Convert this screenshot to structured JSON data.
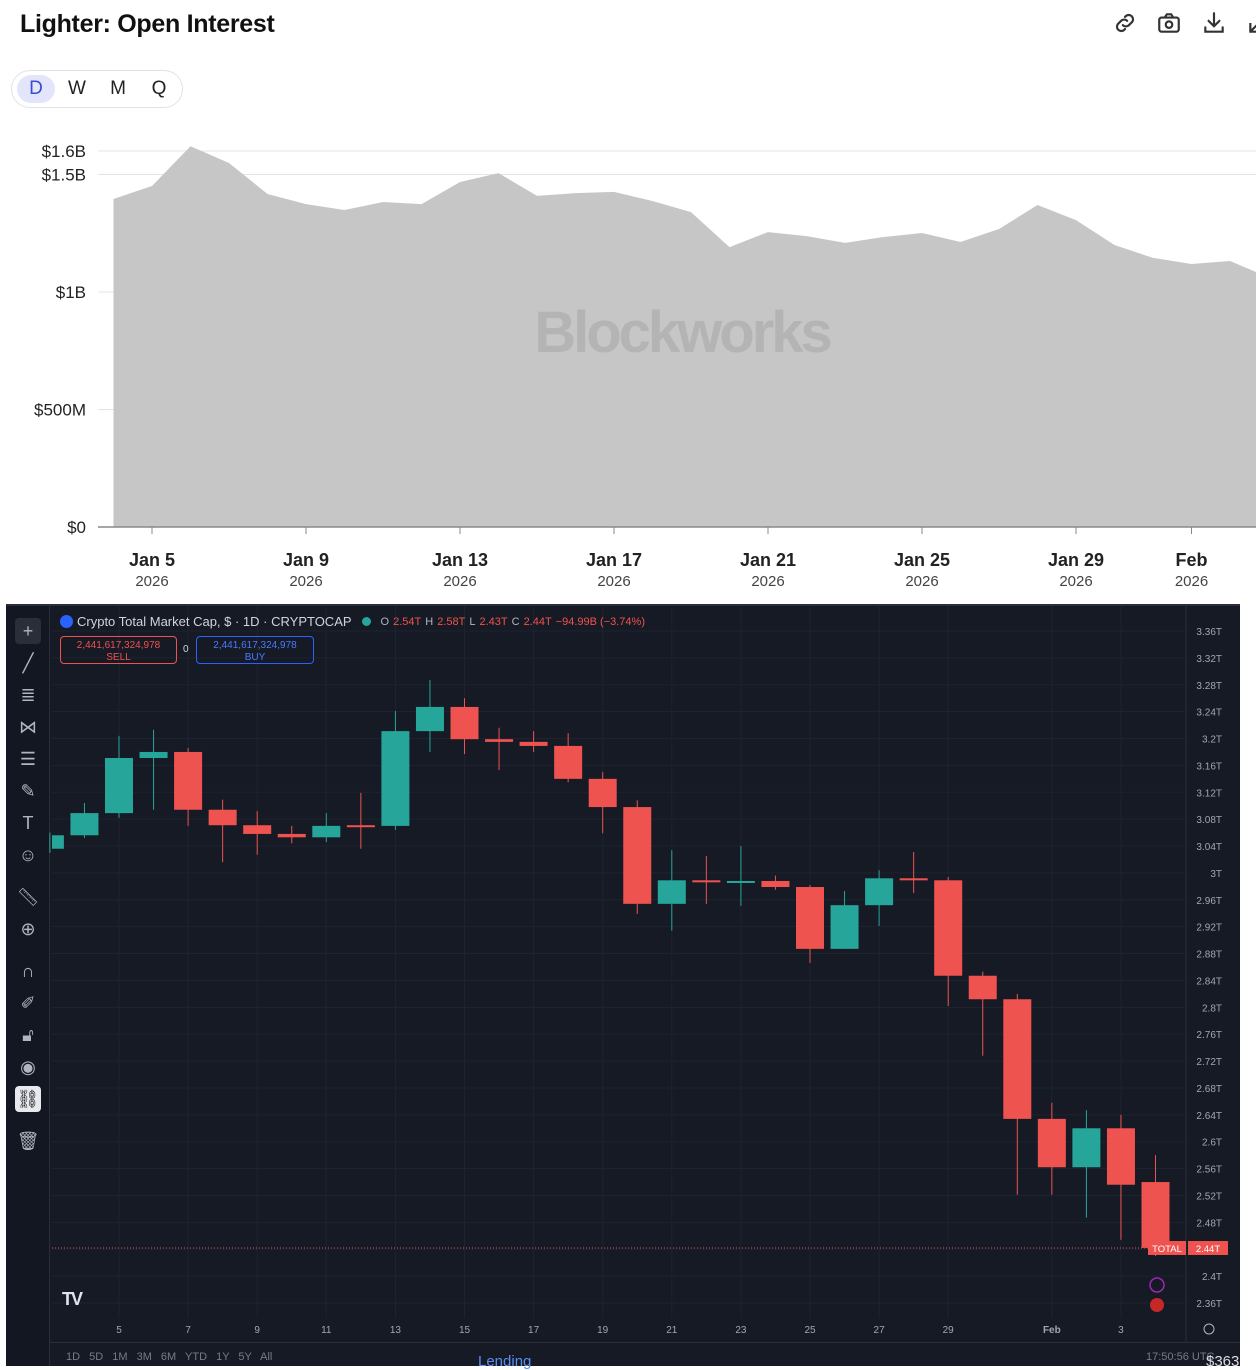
{
  "header": {
    "title": "Lighter: Open Interest",
    "icons": [
      "link-icon",
      "camera-icon",
      "download-icon",
      "collapse-icon"
    ]
  },
  "periods": [
    {
      "label": "D",
      "active": true
    },
    {
      "label": "W",
      "active": false
    },
    {
      "label": "M",
      "active": false
    },
    {
      "label": "Q",
      "active": false
    }
  ],
  "watermark": "Blockworks",
  "chart_data": [
    {
      "type": "area",
      "title": "Lighter: Open Interest",
      "fill_color": "#c6c6c6",
      "ylim": [
        0,
        1650000000
      ],
      "y_ticks": [
        {
          "v": 0,
          "label": "$0"
        },
        {
          "v": 500000000,
          "label": "$500M"
        },
        {
          "v": 1000000000,
          "label": "$1B"
        },
        {
          "v": 1500000000,
          "label": "$1.5B"
        },
        {
          "v": 1600000000,
          "label": "$1.6B"
        }
      ],
      "x_ticks": [
        {
          "day": 5,
          "label": "Jan 5",
          "year": "2026"
        },
        {
          "day": 9,
          "label": "Jan 9",
          "year": "2026"
        },
        {
          "day": 13,
          "label": "Jan 13",
          "year": "2026"
        },
        {
          "day": 17,
          "label": "Jan 17",
          "year": "2026"
        },
        {
          "day": 21,
          "label": "Jan 21",
          "year": "2026"
        },
        {
          "day": 25,
          "label": "Jan 25",
          "year": "2026"
        },
        {
          "day": 29,
          "label": "Jan 29",
          "year": "2026"
        },
        {
          "day": 32,
          "label": "Feb",
          "year": "2026"
        }
      ],
      "x_unit": "day of January 2026 (32 = Feb 1)",
      "x": [
        4,
        5,
        6,
        7,
        8,
        9,
        10,
        11,
        12,
        13,
        14,
        15,
        16,
        17,
        18,
        19,
        20,
        21,
        22,
        23,
        24,
        25,
        26,
        27,
        28,
        29,
        30,
        31,
        32,
        33,
        33.7
      ],
      "values": [
        1396000000.0,
        1451000000.0,
        1620000000.0,
        1549000000.0,
        1417000000.0,
        1374000000.0,
        1349000000.0,
        1383000000.0,
        1374000000.0,
        1468000000.0,
        1506000000.0,
        1409000000.0,
        1421000000.0,
        1426000000.0,
        1387000000.0,
        1340000000.0,
        1191000000.0,
        1255000000.0,
        1238000000.0,
        1209000000.0,
        1234000000.0,
        1251000000.0,
        1213000000.0,
        1268000000.0,
        1370000000.0,
        1306000000.0,
        1200000000.0,
        1145000000.0,
        1119000000.0,
        1132000000.0,
        1085000000.0
      ]
    },
    {
      "type": "candlestick",
      "title": "Crypto Total Market Cap, $ · 1D · CRYPTOCAP",
      "unit": "T",
      "ylim": [
        2.36,
        3.36
      ],
      "up_color": "#26a69a",
      "down_color": "#ef5350",
      "y_ticks": [
        "3.36T",
        "3.32T",
        "3.28T",
        "3.24T",
        "3.2T",
        "3.16T",
        "3.12T",
        "3.08T",
        "3.04T",
        "3T",
        "2.96T",
        "2.92T",
        "2.88T",
        "2.84T",
        "2.8T",
        "2.76T",
        "2.72T",
        "2.68T",
        "2.64T",
        "2.6T",
        "2.56T",
        "2.52T",
        "2.48T",
        "2.44T",
        "2.4T",
        "2.36T"
      ],
      "x_ticks": [
        {
          "day": 5,
          "label": "5"
        },
        {
          "day": 7,
          "label": "7"
        },
        {
          "day": 9,
          "label": "9"
        },
        {
          "day": 11,
          "label": "11"
        },
        {
          "day": 13,
          "label": "13"
        },
        {
          "day": 15,
          "label": "15"
        },
        {
          "day": 17,
          "label": "17"
        },
        {
          "day": 19,
          "label": "19"
        },
        {
          "day": 21,
          "label": "21"
        },
        {
          "day": 23,
          "label": "23"
        },
        {
          "day": 25,
          "label": "25"
        },
        {
          "day": 27,
          "label": "27"
        },
        {
          "day": 29,
          "label": "29"
        },
        {
          "day": 32,
          "label": "Feb"
        },
        {
          "day": 34,
          "label": "3"
        }
      ],
      "candles": [
        {
          "day": 3,
          "o": 3.036,
          "h": 3.06,
          "l": 3.03,
          "c": 3.056
        },
        {
          "day": 4,
          "o": 3.056,
          "h": 3.104,
          "l": 3.052,
          "c": 3.089
        },
        {
          "day": 5,
          "o": 3.089,
          "h": 3.204,
          "l": 3.082,
          "c": 3.171
        },
        {
          "day": 6,
          "o": 3.171,
          "h": 3.213,
          "l": 3.094,
          "c": 3.18
        },
        {
          "day": 7,
          "o": 3.18,
          "h": 3.186,
          "l": 3.07,
          "c": 3.094
        },
        {
          "day": 8,
          "o": 3.094,
          "h": 3.109,
          "l": 3.016,
          "c": 3.071
        },
        {
          "day": 9,
          "o": 3.071,
          "h": 3.092,
          "l": 3.027,
          "c": 3.058
        },
        {
          "day": 10,
          "o": 3.058,
          "h": 3.07,
          "l": 3.044,
          "c": 3.053
        },
        {
          "day": 11,
          "o": 3.053,
          "h": 3.089,
          "l": 3.046,
          "c": 3.07
        },
        {
          "day": 12,
          "o": 3.071,
          "h": 3.119,
          "l": 3.036,
          "c": 3.07
        },
        {
          "day": 13,
          "o": 3.07,
          "h": 3.241,
          "l": 3.064,
          "c": 3.211
        },
        {
          "day": 14,
          "o": 3.211,
          "h": 3.287,
          "l": 3.18,
          "c": 3.247
        },
        {
          "day": 15,
          "o": 3.247,
          "h": 3.26,
          "l": 3.177,
          "c": 3.199
        },
        {
          "day": 16,
          "o": 3.199,
          "h": 3.216,
          "l": 3.153,
          "c": 3.195
        },
        {
          "day": 17,
          "o": 3.195,
          "h": 3.211,
          "l": 3.18,
          "c": 3.189
        },
        {
          "day": 18,
          "o": 3.189,
          "h": 3.208,
          "l": 3.135,
          "c": 3.14
        },
        {
          "day": 19,
          "o": 3.14,
          "h": 3.15,
          "l": 3.059,
          "c": 3.098
        },
        {
          "day": 20,
          "o": 3.098,
          "h": 3.108,
          "l": 2.939,
          "c": 2.954
        },
        {
          "day": 21,
          "o": 2.954,
          "h": 3.034,
          "l": 2.914,
          "c": 2.989
        },
        {
          "day": 22,
          "o": 2.989,
          "h": 3.025,
          "l": 2.954,
          "c": 2.986
        },
        {
          "day": 23,
          "o": 2.986,
          "h": 3.04,
          "l": 2.951,
          "c": 2.988
        },
        {
          "day": 24,
          "o": 2.988,
          "h": 2.996,
          "l": 2.975,
          "c": 2.979
        },
        {
          "day": 25,
          "o": 2.979,
          "h": 2.982,
          "l": 2.866,
          "c": 2.887
        },
        {
          "day": 26,
          "o": 2.887,
          "h": 2.973,
          "l": 2.887,
          "c": 2.952
        },
        {
          "day": 27,
          "o": 2.952,
          "h": 3.004,
          "l": 2.921,
          "c": 2.992
        },
        {
          "day": 28,
          "o": 2.992,
          "h": 3.031,
          "l": 2.97,
          "c": 2.989
        },
        {
          "day": 29,
          "o": 2.989,
          "h": 2.994,
          "l": 2.802,
          "c": 2.847
        },
        {
          "day": 30,
          "o": 2.847,
          "h": 2.853,
          "l": 2.728,
          "c": 2.812
        },
        {
          "day": 31,
          "o": 2.812,
          "h": 2.82,
          "l": 2.521,
          "c": 2.634
        },
        {
          "day": 32,
          "o": 2.634,
          "h": 2.658,
          "l": 2.521,
          "c": 2.562
        },
        {
          "day": 33,
          "o": 2.562,
          "h": 2.647,
          "l": 2.487,
          "c": 2.62
        },
        {
          "day": 34,
          "o": 2.62,
          "h": 2.64,
          "l": 2.454,
          "c": 2.536
        },
        {
          "day": 35,
          "o": 2.54,
          "h": 2.58,
          "l": 2.43,
          "c": 2.442
        }
      ],
      "last_price_tag": {
        "symbol": "TOTAL",
        "value": "2.44T",
        "price": 2.442
      }
    }
  ],
  "tv": {
    "symbol_title": "Crypto Total Market Cap, $ · 1D · CRYPTOCAP",
    "ohlc": {
      "o_label": "O",
      "o": "2.54T",
      "h_label": "H",
      "h": "2.58T",
      "l_label": "L",
      "l": "2.43T",
      "c_label": "C",
      "c": "2.44T",
      "change": "−94.99B (−3.74%)"
    },
    "sell_price": "2,441,617,324,978",
    "sell_label": "SELL",
    "buy_price": "2,441,617,324,978",
    "buy_label": "BUY",
    "spread": "0",
    "logo": "TV",
    "bottom_ranges": "1D  5D  1M  3M  6M  YTD  1Y  5Y  All",
    "time": "17:50:56 UTC"
  },
  "background_fragments": {
    "lending": "Lending",
    "price": "$363"
  }
}
